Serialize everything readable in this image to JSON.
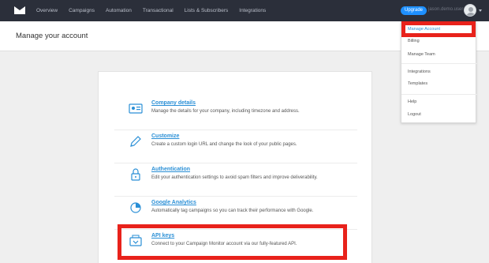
{
  "nav": {
    "items": [
      "Overview",
      "Campaigns",
      "Automation",
      "Transactional",
      "Lists & Subscribers",
      "Integrations"
    ],
    "upgrade_label": "Upgrade",
    "username": "jason.demo.user"
  },
  "page": {
    "title": "Manage your account"
  },
  "settings": [
    {
      "title": "Company details",
      "description": "Manage the details for your company, including timezone and address.",
      "icon": "id-card-icon"
    },
    {
      "title": "Customize",
      "description": "Create a custom login URL and change the look of your public pages.",
      "icon": "pencil-icon"
    },
    {
      "title": "Authentication",
      "description": "Edit your authentication settings to avoid spam filters and improve deliverability.",
      "icon": "lock-icon"
    },
    {
      "title": "Google Analytics",
      "description": "Automatically tag campaigns so you can track their performance with Google.",
      "icon": "pie-chart-icon"
    },
    {
      "title": "API keys",
      "description": "Connect to your Campaign Monitor account via our fully-featured API.",
      "icon": "api-key-icon"
    }
  ],
  "dropdown": {
    "items": [
      "Manage Account",
      "Billing",
      "Manage Team",
      "Integrations",
      "Templates",
      "Help",
      "Logout"
    ]
  },
  "colors": {
    "topbar": "#2b2f3a",
    "link": "#2a8fd6",
    "highlight": "#e8221b",
    "upgrade": "#1e90ff"
  }
}
